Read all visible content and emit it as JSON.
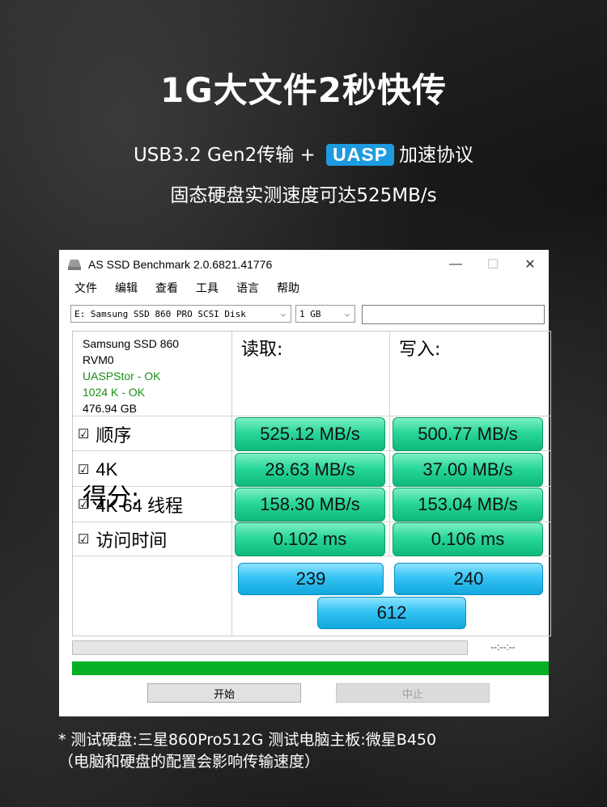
{
  "headline": "1G大文件2秒快传",
  "sub1": {
    "before": "USB3.2 Gen2传输 + ",
    "badge": "UASP",
    "after": "加速协议"
  },
  "sub2": "固态硬盘实测速度可达525MB/s",
  "window": {
    "title": "AS SSD Benchmark 2.0.6821.41776",
    "menu": [
      "文件",
      "编辑",
      "查看",
      "工具",
      "语言",
      "帮助"
    ],
    "drive_select": "E: Samsung SSD 860 PRO SCSI Disk",
    "size_select": "1 GB",
    "drive_info": {
      "model": "Samsung SSD 860",
      "fw": "RVM0",
      "driver": "UASPStor - OK",
      "align": "1024 K - OK",
      "capacity": "476.94 GB"
    },
    "col_read": "读取:",
    "col_write": "写入:",
    "rows": [
      {
        "label": "顺序",
        "read": "525.12 MB/s",
        "write": "500.77 MB/s"
      },
      {
        "label": "4K",
        "read": "28.63 MB/s",
        "write": "37.00 MB/s"
      },
      {
        "label": "4K 64 线程",
        "read": "158.30 MB/s",
        "write": "153.04 MB/s"
      },
      {
        "label": "访问时间",
        "read": "0.102 ms",
        "write": "0.106 ms"
      }
    ],
    "score_label": "得分:",
    "score_read": "239",
    "score_write": "240",
    "score_total": "612",
    "time_display": "--:--:--",
    "start_button": "开始",
    "stop_button": "中止",
    "progress_top": 0,
    "progress_bottom": 1.0
  },
  "note": {
    "line1": "*  测试硬盘:三星860Pro512G   测试电脑主板:微星B450",
    "line2": "（电脑和硬盘的配置会影响传输速度）"
  },
  "colors": {
    "accent": "#1e9be0",
    "result_green": "#2ad79a",
    "score_blue": "#35c3f3",
    "progress_green": "#06b025"
  }
}
